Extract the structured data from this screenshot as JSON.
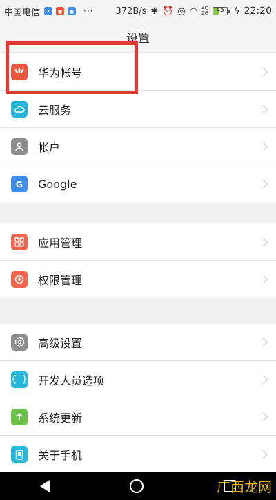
{
  "status_bar": {
    "carrier": "中国电信",
    "dots": "···",
    "speed": "372B/s",
    "net_top": "4G",
    "net_bottom": "2G",
    "battery_level": "45",
    "battery_fraction": 0.45,
    "time": "22:20"
  },
  "header": {
    "title": "设置"
  },
  "groups": [
    {
      "items": [
        {
          "label": "华为帐号",
          "icon": "huawei-icon",
          "color": "#e8573d"
        },
        {
          "label": "云服务",
          "icon": "cloud-icon",
          "color": "#25b6d9"
        },
        {
          "label": "帐户",
          "icon": "person-icon",
          "color": "#8e8e8e"
        },
        {
          "label": "Google",
          "icon": "google-icon",
          "color": "#3f8de8"
        }
      ]
    },
    {
      "items": [
        {
          "label": "应用管理",
          "icon": "apps-grid-icon",
          "color": "#f0654b"
        },
        {
          "label": "权限管理",
          "icon": "permission-icon",
          "color": "#f0654b"
        }
      ]
    },
    {
      "items": [
        {
          "label": "高级设置",
          "icon": "gear-icon",
          "color": "#8e8e8e"
        },
        {
          "label": "开发人员选项",
          "icon": "braces-icon",
          "color": "#25b6d9"
        },
        {
          "label": "系统更新",
          "icon": "update-arrow-icon",
          "color": "#6cc04a"
        },
        {
          "label": "关于手机",
          "icon": "phone-icon",
          "color": "#25b6d9"
        }
      ]
    }
  ],
  "watermark": "广西龙网"
}
